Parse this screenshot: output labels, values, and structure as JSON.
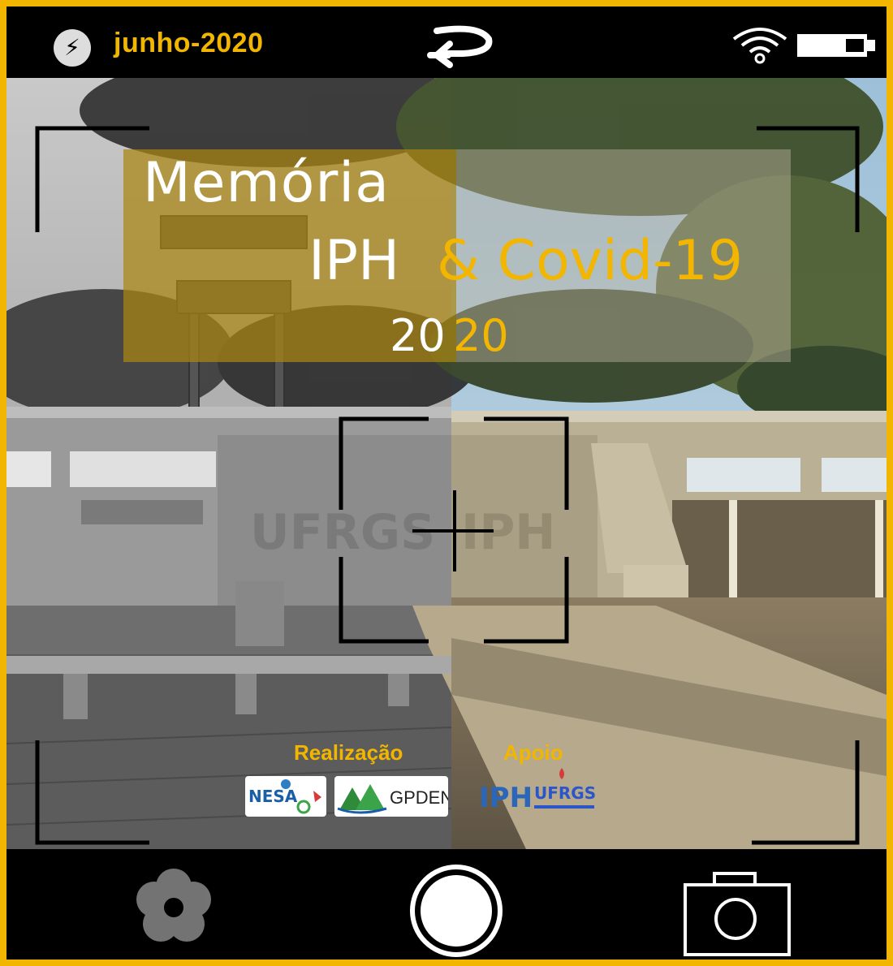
{
  "status_bar": {
    "flash_icon": "flash-auto-icon",
    "date_label": "junho-2020",
    "rotate_icon": "rotate-camera-icon",
    "wifi_icon": "wifi-icon",
    "battery_icon": "battery-icon",
    "battery_level": 0.7
  },
  "overlay": {
    "title_line1": "Memória",
    "title_line2_white": "IPH",
    "title_line2_accent": "& Covid-19",
    "year_white": "20",
    "year_accent": "20"
  },
  "credits": {
    "realizacao_label": "Realização",
    "apoio_label": "Apoio",
    "logos": [
      "NESA",
      "GPDEN",
      "IPH",
      "UFRGS"
    ]
  },
  "controls": {
    "gallery_icon": "gallery-flower-icon",
    "shutter_icon": "shutter-button",
    "camera_icon": "camera-icon"
  },
  "colors": {
    "accent": "#f2b600",
    "bar": "#000000"
  }
}
